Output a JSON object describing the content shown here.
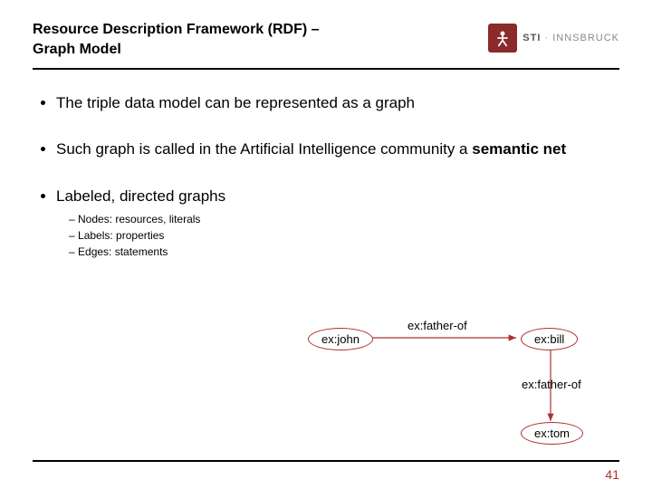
{
  "title_line1": "Resource Description Framework (RDF) –",
  "title_line2": "Graph Model",
  "logo": {
    "name": "STI",
    "sub": "INNSBRUCK"
  },
  "bullets": {
    "b1": "The triple data model can be represented as a graph",
    "b2_pre": "Such graph is called in the Artificial Intelligence community a ",
    "b2_bold": "semantic net",
    "b3": "Labeled, directed graphs",
    "sub": [
      {
        "term": "Nodes:",
        "desc": " resources, literals"
      },
      {
        "term": "Labels:",
        "desc": " properties"
      },
      {
        "term": "Edges:",
        "desc": " statements"
      }
    ]
  },
  "graph": {
    "node_john": "ex:john",
    "node_bill": "ex:bill",
    "node_tom": "ex:tom",
    "edge1": "ex:father-of",
    "edge2": "ex:father-of"
  },
  "page_number": "41"
}
